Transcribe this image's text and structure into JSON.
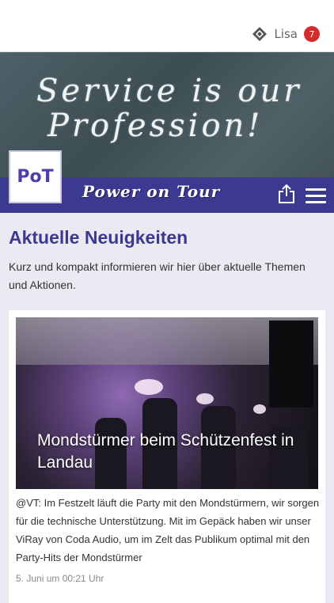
{
  "header": {
    "user_name": "Lisa",
    "notification_count": "7",
    "user_icon": "user-badge-icon"
  },
  "hero": {
    "slogan_line1": "Service is our",
    "slogan_line2": "Profession!",
    "logo_text": "PoT",
    "brand_name": "Power on Tour",
    "share_icon": "share-icon",
    "menu_icon": "hamburger-menu-icon"
  },
  "main": {
    "title": "Aktuelle Neuigkeiten",
    "intro": "Kurz und kompakt informieren wir hier über aktuelle Themen und Aktionen."
  },
  "news": [
    {
      "title": "Mondstürmer beim Schützenfest in Landau",
      "text": "@VT: Im Festzelt läuft die Party mit den Mondstürmern, wir sorgen für die technische Unterstützung. Mit im Gepäck haben wir unser ViRay von Coda Audio, um im Zelt das Publikum optimal mit den Party-Hits der Mondstürmer",
      "date": "5. Juni um 00:21 Uhr"
    }
  ],
  "colors": {
    "brand": "#3b3990",
    "badge": "#d62b2b",
    "background": "#ebe9f2"
  }
}
